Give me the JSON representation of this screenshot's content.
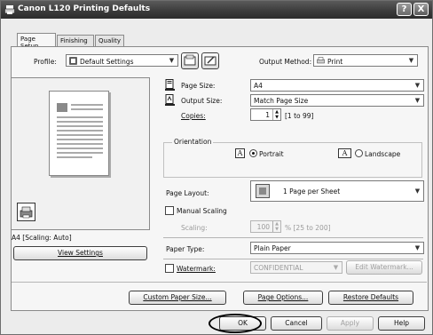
{
  "window": {
    "title": "Canon L120 Printing Defaults"
  },
  "title_buttons": {
    "help": "?",
    "close": "X"
  },
  "tabs": [
    "Page Setup",
    "Finishing",
    "Quality"
  ],
  "profile": {
    "label": "Profile:",
    "value": "Default Settings"
  },
  "output_method": {
    "label": "Output Method:",
    "value": "Print"
  },
  "page_size": {
    "label": "Page Size:",
    "value": "A4"
  },
  "output_size": {
    "label": "Output Size:",
    "value": "Match Page Size"
  },
  "copies": {
    "label": "Copies:",
    "value": "1",
    "range": "[1 to 99]"
  },
  "orientation": {
    "label": "Orientation",
    "portrait": "Portrait",
    "landscape": "Landscape",
    "glyph": "A",
    "selected": "Portrait"
  },
  "page_layout": {
    "label": "Page Layout:",
    "value": "1 Page per Sheet"
  },
  "manual_scaling": {
    "label": "Manual Scaling",
    "checked": false
  },
  "scaling": {
    "label": "Scaling:",
    "value": "100",
    "range": "% [25 to 200]"
  },
  "paper_type": {
    "label": "Paper Type:",
    "value": "Plain Paper"
  },
  "watermark": {
    "label": "Watermark:",
    "value": "CONFIDENTIAL",
    "edit_button": "Edit Watermark...",
    "checked": false
  },
  "preview": {
    "caption": "A4 [Scaling: Auto]",
    "view_button": "View Settings"
  },
  "panel_buttons": {
    "custom_paper": "Custom Paper Size...",
    "page_options": "Page Options...",
    "restore": "Restore Defaults"
  },
  "dialog_buttons": {
    "ok": "OK",
    "cancel": "Cancel",
    "apply": "Apply",
    "help": "Help"
  }
}
